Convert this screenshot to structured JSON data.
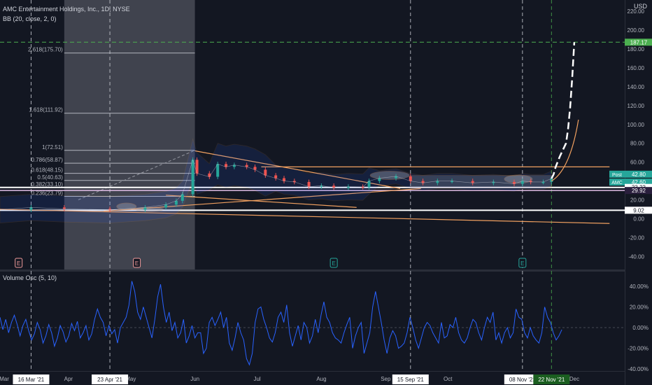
{
  "header": {
    "symbol_line": "AMC Entertainment Holdings, Inc., 1D, NYSE",
    "indicator_line": "BB (20, close, 2, 0)",
    "currency": "USD"
  },
  "chart_data": [
    {
      "type": "candlestick",
      "symbol": "AMC",
      "interval": "1D",
      "exchange": "NYSE",
      "currency": "USD",
      "y_ticks": [
        "220.00",
        "200.00",
        "180.00",
        "160.00",
        "140.00",
        "120.00",
        "100.00",
        "80.00",
        "60.00",
        "40.00",
        "20.00",
        "0.00",
        "-20.00",
        "-40.00"
      ],
      "ylim": [
        -42,
        226
      ],
      "x_ticks": [
        "Mar",
        "Apr",
        "May",
        "Jun",
        "Jul",
        "Aug",
        "Sep",
        "Oct",
        "Nov",
        "Dec"
      ],
      "date_markers": [
        "16 Mar '21",
        "23 Apr '21",
        "15 Sep '21",
        "08 Nov '21",
        "22 Nov '21"
      ],
      "price_labels": [
        {
          "text": "187.17",
          "value": 187.17,
          "color": "#4caf50"
        },
        {
          "text": "42.80",
          "prefix": "Post",
          "value": 42.8,
          "color": "#26a69a"
        },
        {
          "text": "42.60",
          "prefix": "AMC",
          "value": 42.6,
          "color": "#26a69a"
        },
        {
          "text": "33.23",
          "value": 33.23,
          "color": "#ffffff"
        },
        {
          "text": "29.92",
          "value": 29.92,
          "color": "#2a1f3d"
        },
        {
          "text": "9.02",
          "value": 9.02,
          "color": "#ffffff"
        }
      ],
      "fibonacci_levels": [
        {
          "label": "2.618(175.70)",
          "value": 175.7
        },
        {
          "label": "1.618(111.92)",
          "value": 111.92
        },
        {
          "label": "1(72.51)",
          "value": 72.51
        },
        {
          "label": "0.786(58.87)",
          "value": 58.87
        },
        {
          "label": "0.618(48.15)",
          "value": 48.15
        },
        {
          "label": "0.5(40.63)",
          "value": 40.63
        },
        {
          "label": "0.382(33.10)",
          "value": 33.1
        },
        {
          "label": "0.236(23.79)",
          "value": 23.79
        }
      ],
      "horizontal_lines": [
        33.23,
        29.92,
        9.02
      ],
      "close_series": [
        [
          "2021-03-01",
          9.5
        ],
        [
          "2021-03-16",
          12.0
        ],
        [
          "2021-04-01",
          10.5
        ],
        [
          "2021-04-23",
          9.5
        ],
        [
          "2021-05-10",
          12.0
        ],
        [
          "2021-05-20",
          15.0
        ],
        [
          "2021-05-25",
          19.0
        ],
        [
          "2021-05-28",
          26.0
        ],
        [
          "2021-06-02",
          62.5
        ],
        [
          "2021-06-04",
          48.0
        ],
        [
          "2021-06-10",
          44.5
        ],
        [
          "2021-06-14",
          58.0
        ],
        [
          "2021-06-18",
          55.0
        ],
        [
          "2021-06-22",
          57.0
        ],
        [
          "2021-06-28",
          55.0
        ],
        [
          "2021-07-02",
          52.0
        ],
        [
          "2021-07-07",
          46.0
        ],
        [
          "2021-07-12",
          43.0
        ],
        [
          "2021-07-16",
          40.0
        ],
        [
          "2021-07-21",
          39.0
        ],
        [
          "2021-07-28",
          34.0
        ],
        [
          "2021-08-03",
          35.0
        ],
        [
          "2021-08-09",
          33.0
        ],
        [
          "2021-08-16",
          34.0
        ],
        [
          "2021-08-23",
          33.5
        ],
        [
          "2021-08-26",
          40.0
        ],
        [
          "2021-08-31",
          43.0
        ],
        [
          "2021-09-08",
          45.0
        ],
        [
          "2021-09-15",
          40.0
        ],
        [
          "2021-09-21",
          38.0
        ],
        [
          "2021-09-28",
          40.0
        ],
        [
          "2021-10-05",
          40.0
        ],
        [
          "2021-10-15",
          38.0
        ],
        [
          "2021-10-25",
          39.0
        ],
        [
          "2021-11-04",
          37.0
        ],
        [
          "2021-11-08",
          40.0
        ],
        [
          "2021-11-12",
          39.0
        ],
        [
          "2021-11-18",
          39.0
        ],
        [
          "2021-11-22",
          42.6
        ]
      ],
      "projection_series": [
        [
          "2021-11-22",
          42.6
        ],
        [
          "2021-11-23",
          47.0
        ],
        [
          "2021-11-24",
          55.0
        ],
        [
          "2021-11-26",
          66.0
        ],
        [
          "2021-11-29",
          80.0
        ],
        [
          "2021-11-30",
          95.0
        ],
        [
          "2021-12-01",
          118.0
        ],
        [
          "2021-12-02",
          150.0
        ],
        [
          "2021-12-03",
          187.17
        ]
      ],
      "earnings_markers": [
        {
          "label": "E",
          "date": "2021-03-10"
        },
        {
          "label": "E",
          "date": "2021-05-06"
        },
        {
          "label": "E",
          "date": "2021-08-09"
        },
        {
          "label": "E",
          "date": "2021-11-08"
        }
      ]
    },
    {
      "type": "line",
      "title": "Volume Osc (5, 10)",
      "y_ticks": [
        "40.00%",
        "20.00%",
        "0.00%",
        "-20.00%",
        "-40.00%"
      ],
      "ylim": [
        -42,
        45
      ],
      "series": [
        {
          "color": "#2962ff",
          "values": [
            10,
            -2,
            8,
            -5,
            5,
            12,
            3,
            -8,
            2,
            8,
            -3,
            -12,
            -6,
            5,
            -2,
            -15,
            -8,
            3,
            -5,
            -18,
            -10,
            2,
            -4,
            -14,
            -8,
            4,
            -3,
            6,
            -10,
            -5,
            2,
            -12,
            -6,
            8,
            18,
            10,
            5,
            -8,
            2,
            -6,
            -2,
            -15,
            0,
            5,
            10,
            22,
            45,
            35,
            15,
            8,
            20,
            10,
            0,
            -10,
            8,
            30,
            42,
            20,
            5,
            15,
            -3,
            5,
            -10,
            -5,
            8,
            -15,
            -8,
            2,
            -10,
            -5,
            -5,
            -25,
            -20,
            5,
            10,
            2,
            8,
            15,
            0,
            10,
            -15,
            -22,
            -10,
            5,
            -5,
            -12,
            -30,
            -36,
            -25,
            5,
            18,
            20,
            8,
            0,
            -10,
            -14,
            -5,
            10,
            15,
            5,
            22,
            -5,
            -18,
            -8,
            2,
            -12,
            5,
            0,
            -15,
            -8,
            8,
            -5,
            12,
            25,
            10,
            5,
            -5,
            -10,
            -12,
            -15,
            -5,
            3,
            10,
            -20,
            -8,
            0,
            5,
            -25,
            -15,
            -5,
            20,
            35,
            20,
            5,
            -12,
            -25,
            -10,
            -3,
            -8,
            -20,
            -18,
            -15,
            -5,
            10,
            0,
            -12,
            -20,
            -10,
            0,
            5,
            2,
            -5,
            -10,
            -15,
            5,
            -10,
            -8,
            3,
            0,
            10,
            -5,
            -12,
            -15,
            -10,
            0,
            8,
            5,
            -5,
            -12,
            0,
            10,
            5,
            15,
            -12,
            -5,
            -15,
            -5,
            0,
            -10,
            -5,
            18,
            10,
            8,
            -5,
            -10,
            0,
            -8,
            -12,
            -15,
            -5,
            20,
            10,
            5,
            -5,
            -12,
            -8,
            -2
          ]
        }
      ]
    }
  ]
}
